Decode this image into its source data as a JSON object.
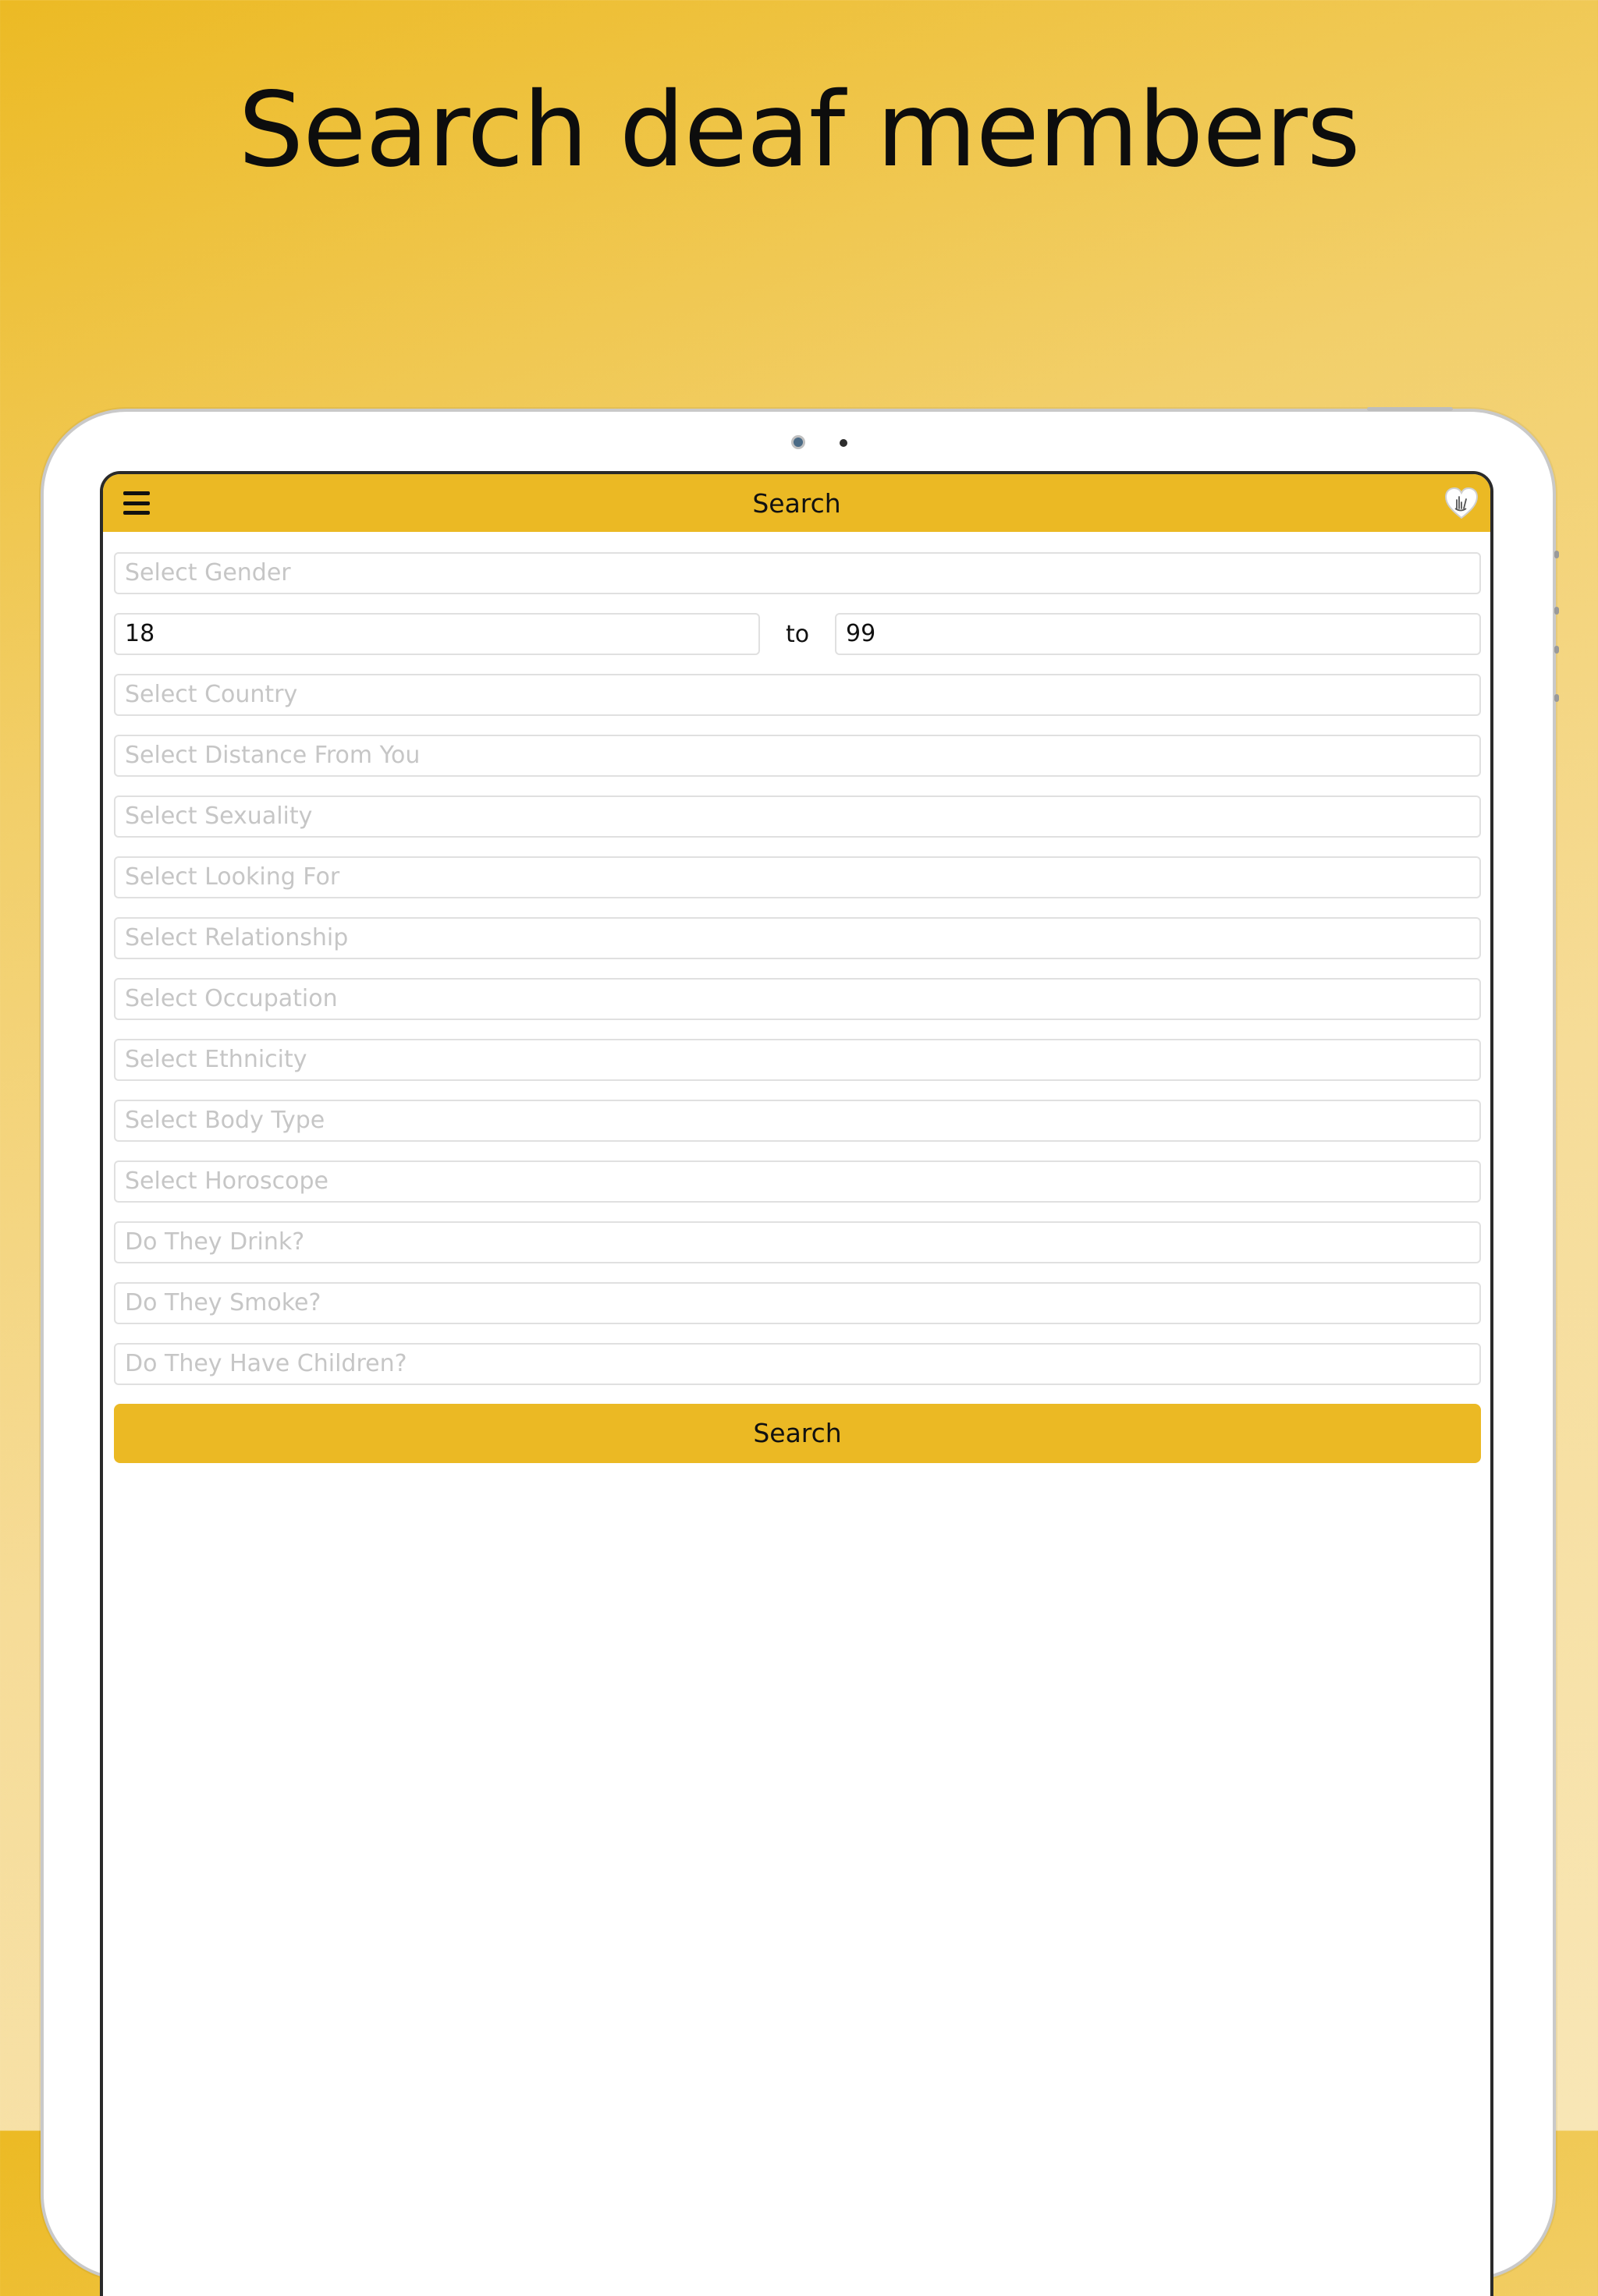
{
  "headline": "Search deaf members",
  "navbar": {
    "title": "Search",
    "menu_icon": "hamburger-menu-icon",
    "logo_icon": "heart-sign-language-logo-icon"
  },
  "form": {
    "gender_placeholder": "Select Gender",
    "age": {
      "min": "18",
      "separator": "to",
      "max": "99"
    },
    "fields": [
      "Select Country",
      "Select Distance From You",
      "Select Sexuality",
      "Select Looking For",
      "Select Relationship",
      "Select Occupation",
      "Select Ethnicity",
      "Select Body Type",
      "Select Horoscope",
      "Do They Drink?",
      "Do They Smoke?",
      "Do They Have Children?"
    ],
    "search_label": "Search"
  },
  "colors": {
    "accent": "#ebb924",
    "placeholder": "#c6c6c6",
    "border": "#e0e0e0"
  }
}
